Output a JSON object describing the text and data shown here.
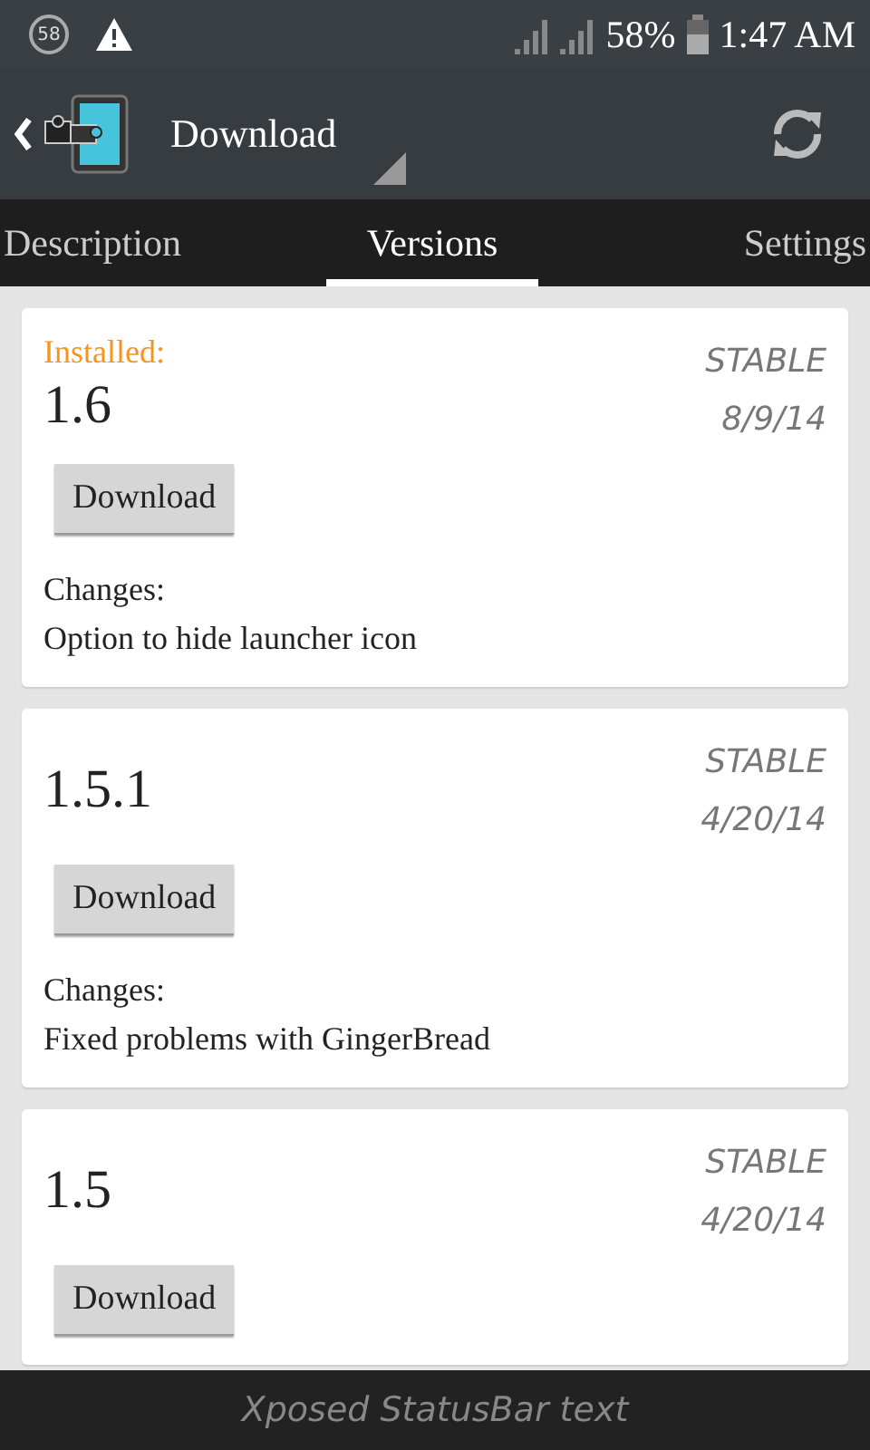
{
  "status_bar": {
    "notification_count": "58",
    "battery": "58%",
    "time": "1:47 AM"
  },
  "action_bar": {
    "title": "Download"
  },
  "tabs": [
    {
      "label": "Description",
      "selected": false
    },
    {
      "label": "Versions",
      "selected": true
    },
    {
      "label": "Settings",
      "selected": false
    }
  ],
  "versions": [
    {
      "installed_label": "Installed:",
      "version": "1.6",
      "release_type": "STABLE",
      "date": "8/9/14",
      "button": "Download",
      "changes_label": "Changes:",
      "changes": "Option to hide launcher icon"
    },
    {
      "version": "1.5.1",
      "release_type": "STABLE",
      "date": "4/20/14",
      "button": "Download",
      "changes_label": "Changes:",
      "changes": "Fixed problems with GingerBread"
    },
    {
      "version": "1.5",
      "release_type": "STABLE",
      "date": "4/20/14",
      "button": "Download"
    }
  ],
  "footer": {
    "text": "Xposed StatusBar text"
  }
}
